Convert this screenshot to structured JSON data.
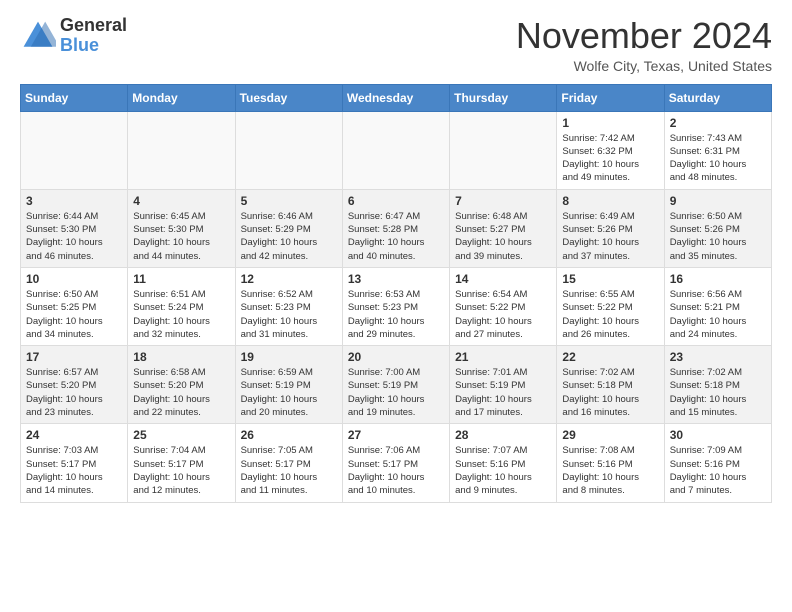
{
  "header": {
    "logo_general": "General",
    "logo_blue": "Blue",
    "month_title": "November 2024",
    "location": "Wolfe City, Texas, United States"
  },
  "days_of_week": [
    "Sunday",
    "Monday",
    "Tuesday",
    "Wednesday",
    "Thursday",
    "Friday",
    "Saturday"
  ],
  "weeks": [
    {
      "bg": "white",
      "days": [
        {
          "date": "",
          "info": ""
        },
        {
          "date": "",
          "info": ""
        },
        {
          "date": "",
          "info": ""
        },
        {
          "date": "",
          "info": ""
        },
        {
          "date": "",
          "info": ""
        },
        {
          "date": "1",
          "info": "Sunrise: 7:42 AM\nSunset: 6:32 PM\nDaylight: 10 hours\nand 49 minutes."
        },
        {
          "date": "2",
          "info": "Sunrise: 7:43 AM\nSunset: 6:31 PM\nDaylight: 10 hours\nand 48 minutes."
        }
      ]
    },
    {
      "bg": "light",
      "days": [
        {
          "date": "3",
          "info": "Sunrise: 6:44 AM\nSunset: 5:30 PM\nDaylight: 10 hours\nand 46 minutes."
        },
        {
          "date": "4",
          "info": "Sunrise: 6:45 AM\nSunset: 5:30 PM\nDaylight: 10 hours\nand 44 minutes."
        },
        {
          "date": "5",
          "info": "Sunrise: 6:46 AM\nSunset: 5:29 PM\nDaylight: 10 hours\nand 42 minutes."
        },
        {
          "date": "6",
          "info": "Sunrise: 6:47 AM\nSunset: 5:28 PM\nDaylight: 10 hours\nand 40 minutes."
        },
        {
          "date": "7",
          "info": "Sunrise: 6:48 AM\nSunset: 5:27 PM\nDaylight: 10 hours\nand 39 minutes."
        },
        {
          "date": "8",
          "info": "Sunrise: 6:49 AM\nSunset: 5:26 PM\nDaylight: 10 hours\nand 37 minutes."
        },
        {
          "date": "9",
          "info": "Sunrise: 6:50 AM\nSunset: 5:26 PM\nDaylight: 10 hours\nand 35 minutes."
        }
      ]
    },
    {
      "bg": "white",
      "days": [
        {
          "date": "10",
          "info": "Sunrise: 6:50 AM\nSunset: 5:25 PM\nDaylight: 10 hours\nand 34 minutes."
        },
        {
          "date": "11",
          "info": "Sunrise: 6:51 AM\nSunset: 5:24 PM\nDaylight: 10 hours\nand 32 minutes."
        },
        {
          "date": "12",
          "info": "Sunrise: 6:52 AM\nSunset: 5:23 PM\nDaylight: 10 hours\nand 31 minutes."
        },
        {
          "date": "13",
          "info": "Sunrise: 6:53 AM\nSunset: 5:23 PM\nDaylight: 10 hours\nand 29 minutes."
        },
        {
          "date": "14",
          "info": "Sunrise: 6:54 AM\nSunset: 5:22 PM\nDaylight: 10 hours\nand 27 minutes."
        },
        {
          "date": "15",
          "info": "Sunrise: 6:55 AM\nSunset: 5:22 PM\nDaylight: 10 hours\nand 26 minutes."
        },
        {
          "date": "16",
          "info": "Sunrise: 6:56 AM\nSunset: 5:21 PM\nDaylight: 10 hours\nand 24 minutes."
        }
      ]
    },
    {
      "bg": "light",
      "days": [
        {
          "date": "17",
          "info": "Sunrise: 6:57 AM\nSunset: 5:20 PM\nDaylight: 10 hours\nand 23 minutes."
        },
        {
          "date": "18",
          "info": "Sunrise: 6:58 AM\nSunset: 5:20 PM\nDaylight: 10 hours\nand 22 minutes."
        },
        {
          "date": "19",
          "info": "Sunrise: 6:59 AM\nSunset: 5:19 PM\nDaylight: 10 hours\nand 20 minutes."
        },
        {
          "date": "20",
          "info": "Sunrise: 7:00 AM\nSunset: 5:19 PM\nDaylight: 10 hours\nand 19 minutes."
        },
        {
          "date": "21",
          "info": "Sunrise: 7:01 AM\nSunset: 5:19 PM\nDaylight: 10 hours\nand 17 minutes."
        },
        {
          "date": "22",
          "info": "Sunrise: 7:02 AM\nSunset: 5:18 PM\nDaylight: 10 hours\nand 16 minutes."
        },
        {
          "date": "23",
          "info": "Sunrise: 7:02 AM\nSunset: 5:18 PM\nDaylight: 10 hours\nand 15 minutes."
        }
      ]
    },
    {
      "bg": "white",
      "days": [
        {
          "date": "24",
          "info": "Sunrise: 7:03 AM\nSunset: 5:17 PM\nDaylight: 10 hours\nand 14 minutes."
        },
        {
          "date": "25",
          "info": "Sunrise: 7:04 AM\nSunset: 5:17 PM\nDaylight: 10 hours\nand 12 minutes."
        },
        {
          "date": "26",
          "info": "Sunrise: 7:05 AM\nSunset: 5:17 PM\nDaylight: 10 hours\nand 11 minutes."
        },
        {
          "date": "27",
          "info": "Sunrise: 7:06 AM\nSunset: 5:17 PM\nDaylight: 10 hours\nand 10 minutes."
        },
        {
          "date": "28",
          "info": "Sunrise: 7:07 AM\nSunset: 5:16 PM\nDaylight: 10 hours\nand 9 minutes."
        },
        {
          "date": "29",
          "info": "Sunrise: 7:08 AM\nSunset: 5:16 PM\nDaylight: 10 hours\nand 8 minutes."
        },
        {
          "date": "30",
          "info": "Sunrise: 7:09 AM\nSunset: 5:16 PM\nDaylight: 10 hours\nand 7 minutes."
        }
      ]
    }
  ]
}
